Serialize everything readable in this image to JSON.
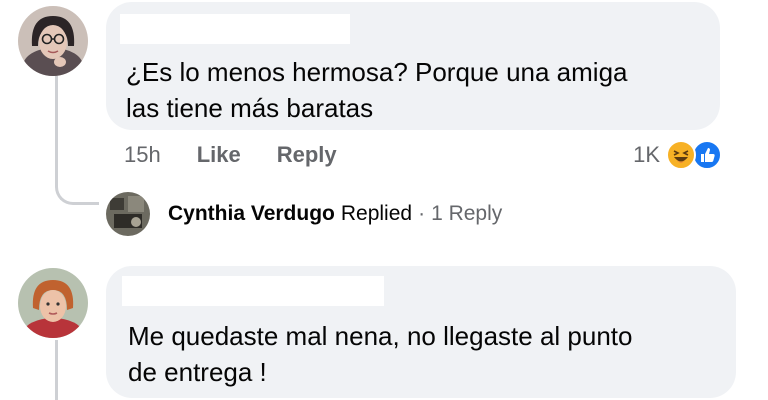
{
  "comments": [
    {
      "text_line1": "¿Es lo menos hermosa? Porque una amiga",
      "text_line2": "las tiene más baratas",
      "time": "15h",
      "like_label": "Like",
      "reply_label": "Reply",
      "reaction_count": "1K",
      "reaction_icons": [
        "haha-emoji",
        "like-thumb"
      ],
      "colors": {
        "haha": "#f7b125",
        "like": "#1877f2"
      }
    },
    {
      "text_line1": "Me quedaste mal nena, no llegaste al punto",
      "text_line2": "de entrega !"
    }
  ],
  "reply_summary": {
    "author": "Cynthia Verdugo",
    "action": "Replied",
    "separator": "·",
    "count": "1 Reply"
  },
  "colors": {
    "bubble": "#f0f2f5",
    "muted_text": "#65676b",
    "thread_line": "#ced0d4"
  }
}
